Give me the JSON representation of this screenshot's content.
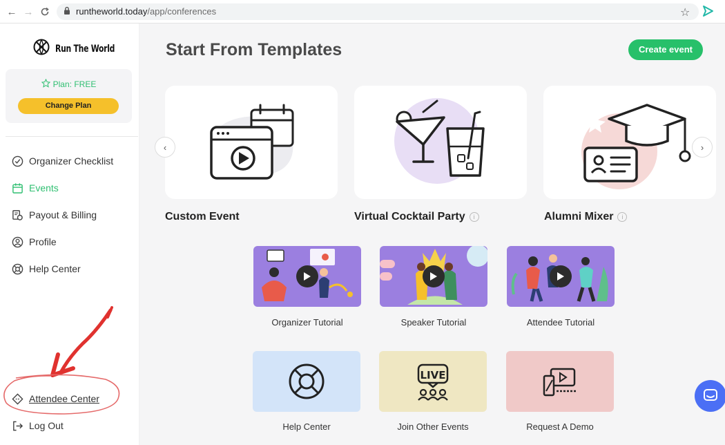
{
  "browser": {
    "domain": "runtheworld.today",
    "path": "/app/conferences"
  },
  "sidebar": {
    "logo_text": "Run The World",
    "plan_label": "Plan: FREE",
    "change_plan_label": "Change Plan",
    "menu": [
      {
        "label": "Organizer Checklist",
        "icon": "check-circle-icon"
      },
      {
        "label": "Events",
        "icon": "calendar-icon",
        "active": true
      },
      {
        "label": "Payout & Billing",
        "icon": "billing-icon"
      },
      {
        "label": "Profile",
        "icon": "user-icon"
      },
      {
        "label": "Help Center",
        "icon": "lifebuoy-icon"
      }
    ],
    "attendee_center": "Attendee Center",
    "log_out": "Log Out"
  },
  "main": {
    "title": "Start From Templates",
    "create_event_label": "Create event",
    "templates": [
      {
        "name": "Custom Event"
      },
      {
        "name": "Virtual Cocktail Party"
      },
      {
        "name": "Alumni Mixer"
      }
    ],
    "tutorials": [
      {
        "label": "Organizer Tutorial"
      },
      {
        "label": "Speaker Tutorial"
      },
      {
        "label": "Attendee Tutorial"
      }
    ],
    "resources": [
      {
        "label": "Help Center"
      },
      {
        "label": "Join Other Events",
        "icon_text": "LIVE"
      },
      {
        "label": "Request A Demo"
      }
    ]
  },
  "colors": {
    "accent_green": "#27c06a",
    "plan_yellow": "#f5c02b",
    "tutorial_purple": "#9b7fe0",
    "help_blue": "#d3e4f9",
    "events_yellow": "#efe7c2",
    "demo_pink": "#f0c9c8",
    "annotation_red": "#e0322f"
  }
}
